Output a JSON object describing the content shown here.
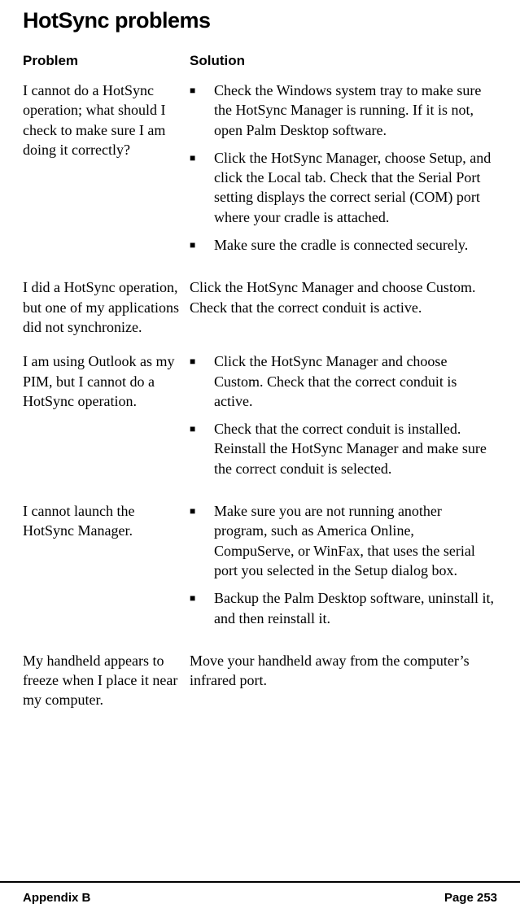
{
  "title": "HotSync problems",
  "headers": {
    "problem": "Problem",
    "solution": "Solution"
  },
  "rows": [
    {
      "problem": "I cannot do a HotSync operation; what should I check to make sure I am doing it correctly?",
      "bullets": [
        "Check the Windows system tray to make sure the HotSync Manager is running. If it is not, open Palm Desktop software.",
        "Click the HotSync Manager, choose Setup, and click the Local tab. Check that the Serial Port setting displays the correct serial (COM) port where your cradle is attached.",
        "Make sure the cradle is connected securely."
      ]
    },
    {
      "problem": "I did a HotSync operation, but one of my applications did not synchronize.",
      "plain": "Click the HotSync Manager and choose Custom. Check that the correct conduit is active."
    },
    {
      "problem": "I am using Outlook as my PIM, but I cannot do a HotSync operation.",
      "bullets": [
        "Click the HotSync Manager and choose Custom. Check that the correct conduit is active.",
        "Check that the correct conduit is installed. Reinstall the HotSync Manager and make sure the correct conduit is selected."
      ]
    },
    {
      "problem": "I cannot launch the HotSync Manager.",
      "bullets": [
        "Make sure you are not running another program, such as America Online, CompuServe, or WinFax, that uses the serial port you selected in the Setup dialog box.",
        "Backup the Palm Desktop software, uninstall it, and then reinstall it."
      ]
    },
    {
      "problem": "My handheld appears to freeze when I place it near my computer.",
      "plain": "Move your handheld away from the computer’s infrared port."
    }
  ],
  "footer": {
    "left": "Appendix B",
    "right": "Page 253"
  }
}
